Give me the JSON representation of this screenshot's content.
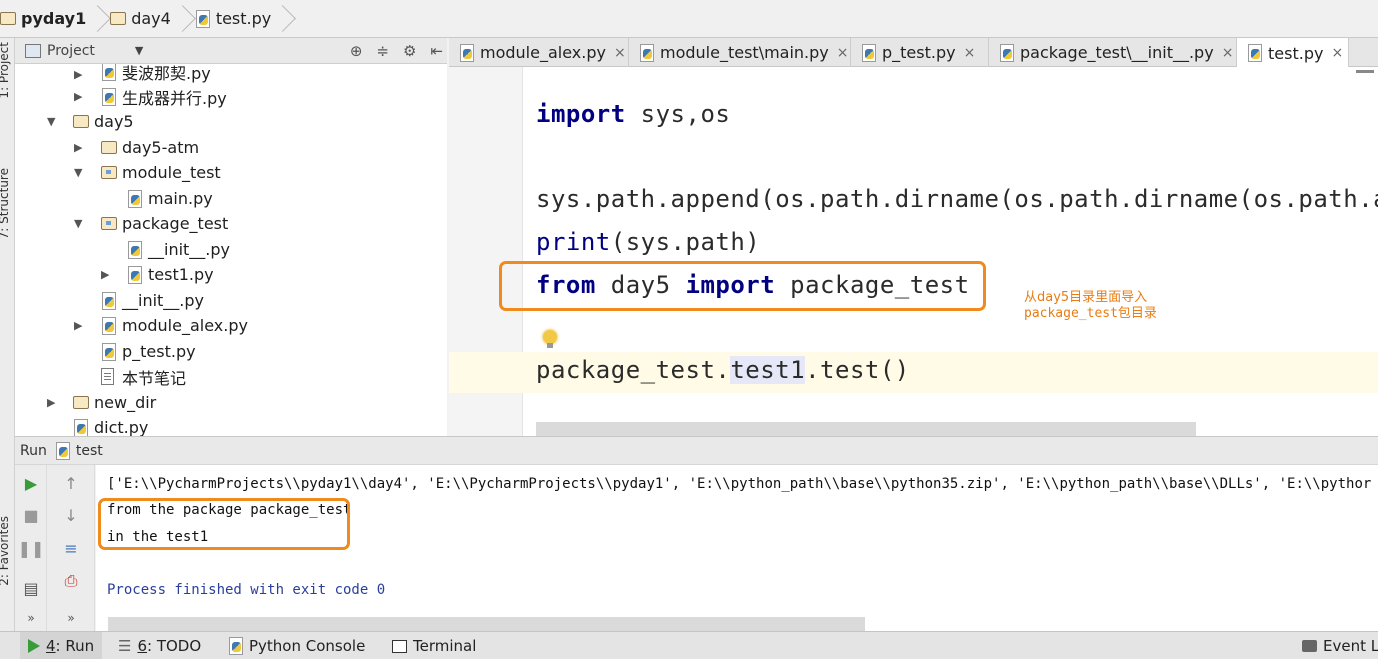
{
  "breadcrumb": [
    {
      "label": "pyday1",
      "icon": "folder-icon"
    },
    {
      "label": "day4",
      "icon": "folder-icon"
    },
    {
      "label": "test.py",
      "icon": "python-file-icon"
    }
  ],
  "project_panel": {
    "title": "Project",
    "tree": [
      {
        "label": "斐波那契.py",
        "type": "py",
        "arrow": "▶"
      },
      {
        "label": "生成器并行.py",
        "type": "py",
        "arrow": "▶"
      },
      {
        "label": "day5",
        "type": "folder",
        "arrow": "▼"
      },
      {
        "label": "day5-atm",
        "type": "folder",
        "arrow": "▶"
      },
      {
        "label": "module_test",
        "type": "package",
        "arrow": "▼"
      },
      {
        "label": "main.py",
        "type": "py",
        "arrow": ""
      },
      {
        "label": "package_test",
        "type": "package",
        "arrow": "▼"
      },
      {
        "label": "__init__.py",
        "type": "py",
        "arrow": ""
      },
      {
        "label": "test1.py",
        "type": "py",
        "arrow": "▶"
      },
      {
        "label": "__init__.py",
        "type": "py",
        "arrow": ""
      },
      {
        "label": "module_alex.py",
        "type": "py",
        "arrow": "▶"
      },
      {
        "label": "p_test.py",
        "type": "py",
        "arrow": ""
      },
      {
        "label": "本节笔记",
        "type": "note",
        "arrow": ""
      },
      {
        "label": "new_dir",
        "type": "folder",
        "arrow": "▶"
      },
      {
        "label": "dict.py",
        "type": "py",
        "arrow": ""
      }
    ]
  },
  "side_strip": {
    "project_label": "1: Project",
    "structure_label": "7: Structure",
    "favorites_label": "2: Favorites"
  },
  "tabs": [
    {
      "label": "module_alex.py",
      "close": "×"
    },
    {
      "label": "module_test\\main.py",
      "close": "×"
    },
    {
      "label": "p_test.py",
      "close": "×"
    },
    {
      "label": "package_test\\__init__.py",
      "close": "×"
    },
    {
      "label": "test.py",
      "close": "×",
      "active": true
    }
  ],
  "editor": {
    "line1_kw": "import",
    "line1_rest": " sys,os",
    "line2": "sys.path.append(os.path.dirname(os.path.dirname(os.path.a",
    "line3_fn": "print",
    "line3_rest": "(sys.path)",
    "line4_kw1": "from",
    "line4_mid": " day5 ",
    "line4_kw2": "import",
    "line4_rest": " package_test",
    "line5_a": "package_test.",
    "line5_hl": "test1",
    "line5_b": ".test()"
  },
  "annotation": {
    "line1": "从day5目录里面导入",
    "line2": "package_test包目录",
    "color": "#f08a1c"
  },
  "run_panel": {
    "title": "Run",
    "config": "test",
    "output": [
      "['E:\\\\PycharmProjects\\\\pyday1\\\\day4', 'E:\\\\PycharmProjects\\\\pyday1', 'E:\\\\python_path\\\\base\\\\python35.zip', 'E:\\\\python_path\\\\base\\\\DLLs', 'E:\\\\pythor",
      "from the package package_test",
      "in the test1",
      "",
      "Process finished with exit code 0"
    ]
  },
  "bottom_tools": [
    {
      "num": "4",
      "label": ": Run"
    },
    {
      "num": "6",
      "label": ": TODO"
    },
    {
      "num": "",
      "label": "Python Console"
    },
    {
      "num": "",
      "label": "Terminal"
    },
    {
      "num": "",
      "label": "Event Lo"
    }
  ]
}
